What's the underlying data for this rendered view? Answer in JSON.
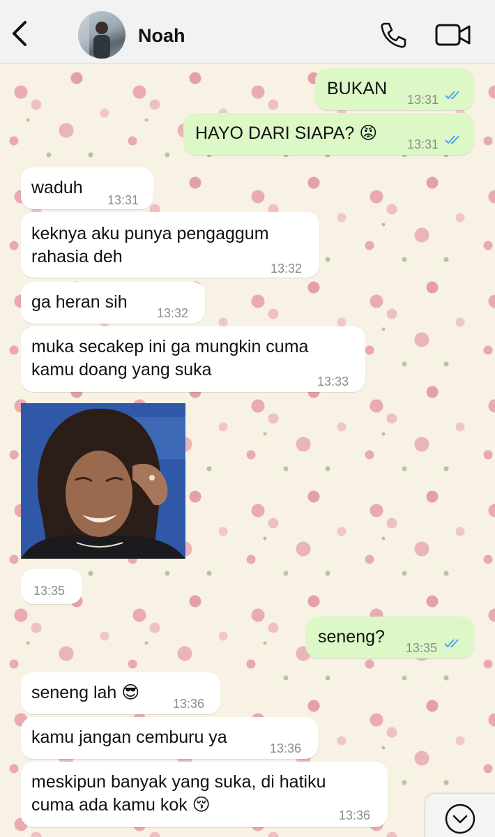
{
  "header": {
    "contact_name": "Noah",
    "back_icon": "chevron-left-icon",
    "call_icon": "phone-icon",
    "video_icon": "video-camera-icon"
  },
  "messages": [
    {
      "dir": "out",
      "text": "BUKAN",
      "time": "13:31",
      "status": "read"
    },
    {
      "dir": "out",
      "text": "HAYO DARI SIAPA? 😡",
      "time": "13:31",
      "status": "read"
    },
    {
      "dir": "in",
      "text": "waduh",
      "time": "13:31"
    },
    {
      "dir": "in",
      "lines": [
        "keknya aku punya pengaggum",
        "rahasia deh"
      ],
      "time": "13:32"
    },
    {
      "dir": "in",
      "text": "ga heran sih",
      "time": "13:32"
    },
    {
      "dir": "in",
      "lines": [
        "muka secakep ini ga mungkin cuma",
        "kamu doang yang suka"
      ],
      "time": "13:33"
    },
    {
      "dir": "in",
      "type": "image",
      "time": "13:35"
    },
    {
      "dir": "out",
      "text": "seneng?",
      "time": "13:35",
      "status": "read"
    },
    {
      "dir": "in",
      "text": "seneng lah 😎",
      "time": "13:36"
    },
    {
      "dir": "in",
      "text": "kamu jangan cemburu ya",
      "time": "13:36"
    },
    {
      "dir": "in",
      "lines": [
        "meskipun banyak yang suka, di hatiku",
        "cuma ada kamu kok 😚"
      ],
      "time": "13:36"
    }
  ],
  "colors": {
    "outgoing_bubble": "#dcf8c6",
    "incoming_bubble": "#ffffff",
    "read_ticks": "#4fa3f7",
    "header_bg": "#f2f2f2"
  },
  "scroll_down_icon": "chevron-down-circle-icon"
}
